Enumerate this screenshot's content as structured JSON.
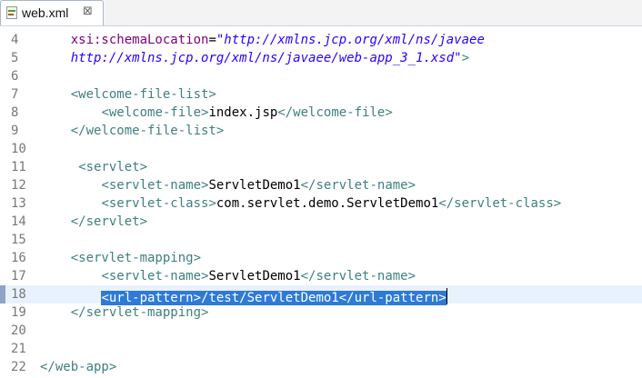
{
  "tab": {
    "title": "web.xml",
    "close_glyph": "⊠"
  },
  "editor": {
    "lines": [
      {
        "num": "4",
        "indent": 2,
        "segments": [
          {
            "cls": "c-attr",
            "text": "xsi:schemaLocation"
          },
          {
            "cls": "c-text",
            "text": "="
          },
          {
            "cls": "c-val",
            "text": "\"http://xmlns.jcp.org/xml/ns/javaee"
          }
        ]
      },
      {
        "num": "5",
        "indent": 2,
        "segments": [
          {
            "cls": "c-val",
            "text": "http://xmlns.jcp.org/xml/ns/javaee/web-app_3_1.xsd\""
          },
          {
            "cls": "c-tag",
            "text": ">"
          }
        ]
      },
      {
        "num": "6",
        "indent": 0,
        "segments": []
      },
      {
        "num": "7",
        "indent": 2,
        "segments": [
          {
            "cls": "c-tag",
            "text": "<welcome-file-list>"
          }
        ]
      },
      {
        "num": "8",
        "indent": 4,
        "segments": [
          {
            "cls": "c-tag",
            "text": "<welcome-file>"
          },
          {
            "cls": "c-text",
            "text": "index.jsp"
          },
          {
            "cls": "c-tag",
            "text": "</welcome-file>"
          }
        ]
      },
      {
        "num": "9",
        "indent": 2,
        "segments": [
          {
            "cls": "c-tag",
            "text": "</welcome-file-list>"
          }
        ]
      },
      {
        "num": "10",
        "indent": 0,
        "segments": []
      },
      {
        "num": "11",
        "indent": 3,
        "segments": [
          {
            "cls": "c-tag",
            "text": "<servlet>"
          }
        ]
      },
      {
        "num": "12",
        "indent": 4,
        "segments": [
          {
            "cls": "c-tag",
            "text": "<servlet-name>"
          },
          {
            "cls": "c-text",
            "text": "ServletDemo1"
          },
          {
            "cls": "c-tag",
            "text": "</servlet-name>"
          }
        ]
      },
      {
        "num": "13",
        "indent": 4,
        "segments": [
          {
            "cls": "c-tag",
            "text": "<servlet-class>"
          },
          {
            "cls": "c-text",
            "text": "com.servlet.demo.ServletDemo1"
          },
          {
            "cls": "c-tag",
            "text": "</servlet-class>"
          }
        ]
      },
      {
        "num": "14",
        "indent": 2,
        "segments": [
          {
            "cls": "c-tag",
            "text": "</servlet>"
          }
        ]
      },
      {
        "num": "15",
        "indent": 0,
        "segments": []
      },
      {
        "num": "16",
        "indent": 2,
        "segments": [
          {
            "cls": "c-tag",
            "text": "<servlet-mapping>"
          }
        ]
      },
      {
        "num": "17",
        "indent": 4,
        "segments": [
          {
            "cls": "c-tag",
            "text": "<servlet-name>"
          },
          {
            "cls": "c-text",
            "text": "ServletDemo1"
          },
          {
            "cls": "c-tag",
            "text": "</servlet-name>"
          }
        ]
      },
      {
        "num": "18",
        "indent": 4,
        "current": true,
        "segments": [
          {
            "cls": "sel",
            "text": "<url-pattern>/test/ServletDemo1</url-pattern>"
          }
        ]
      },
      {
        "num": "19",
        "indent": 2,
        "segments": [
          {
            "cls": "c-tag",
            "text": "</servlet-mapping>"
          }
        ]
      },
      {
        "num": "20",
        "indent": 0,
        "segments": []
      },
      {
        "num": "21",
        "indent": 0,
        "segments": []
      },
      {
        "num": "22",
        "indent": 0,
        "segments": [
          {
            "cls": "c-tag",
            "text": "</web-app>"
          }
        ]
      }
    ]
  }
}
